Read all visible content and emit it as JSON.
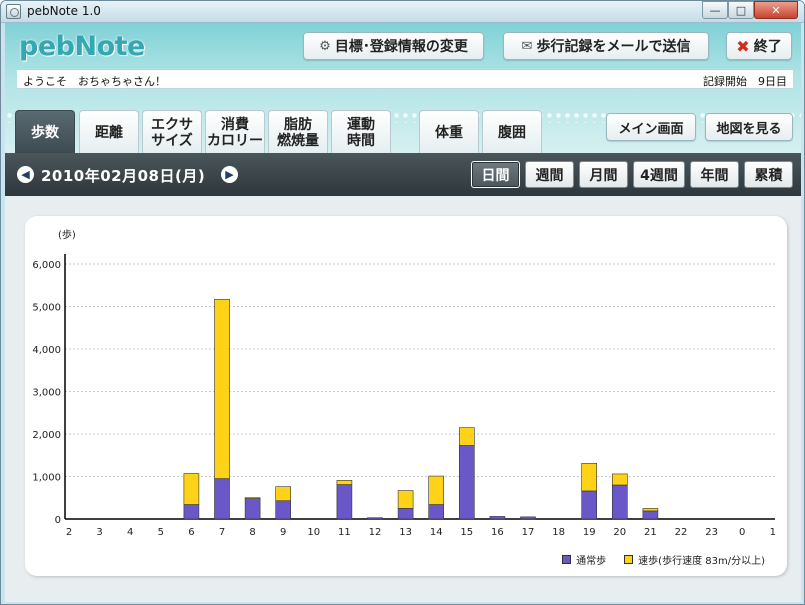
{
  "window": {
    "title": "pebNote 1.0"
  },
  "header": {
    "logo": "pebNote",
    "settings_label": "目標･登録情報の変更",
    "mail_label": "歩行記録をメールで送信",
    "exit_label": "終了",
    "welcome_text": "ようこそ　おちゃちゃさん！",
    "record_text": "記録開始　9日目"
  },
  "tabs": [
    {
      "line1": "歩数",
      "line2": ""
    },
    {
      "line1": "距離",
      "line2": ""
    },
    {
      "line1": "エクサ",
      "line2": "サイズ"
    },
    {
      "line1": "消費",
      "line2": "カロリー"
    },
    {
      "line1": "脂肪",
      "line2": "燃焼量"
    },
    {
      "line1": "運動",
      "line2": "時間"
    },
    {
      "line1": "体重",
      "line2": ""
    },
    {
      "line1": "腹囲",
      "line2": ""
    }
  ],
  "side_buttons": {
    "main": "メイン画面",
    "map": "地図を見る"
  },
  "date_bar": {
    "date": "2010年02月08日(月)",
    "periods": [
      "日間",
      "週間",
      "月間",
      "4週間",
      "年間",
      "累積"
    ],
    "active_period": "日間"
  },
  "colors": {
    "normal": "#6a58c9",
    "fast": "#ffd21a",
    "accent": "#33a8b2"
  },
  "chart_data": {
    "type": "bar",
    "stacked": true,
    "ylabel": "(歩)",
    "ylim": [
      0,
      6000
    ],
    "yticks": [
      "0",
      "1,000",
      "2,000",
      "3,000",
      "4,000",
      "5,000",
      "6,000"
    ],
    "categories": [
      "2",
      "3",
      "4",
      "5",
      "6",
      "7",
      "8",
      "9",
      "10",
      "11",
      "12",
      "13",
      "14",
      "15",
      "16",
      "17",
      "18",
      "19",
      "20",
      "21",
      "22",
      "23",
      "0",
      "1"
    ],
    "series": [
      {
        "name": "通常歩",
        "values": [
          0,
          0,
          0,
          0,
          340,
          950,
          480,
          430,
          0,
          810,
          30,
          250,
          340,
          1730,
          60,
          50,
          0,
          660,
          800,
          190,
          0,
          0,
          0,
          0
        ]
      },
      {
        "name": "速歩(歩行速度 83m/分以上)",
        "values": [
          0,
          0,
          0,
          0,
          730,
          4220,
          20,
          330,
          0,
          100,
          0,
          420,
          670,
          420,
          0,
          0,
          0,
          650,
          260,
          60,
          0,
          0,
          0,
          0
        ]
      }
    ],
    "grid": true,
    "legend": "bottom-right"
  }
}
